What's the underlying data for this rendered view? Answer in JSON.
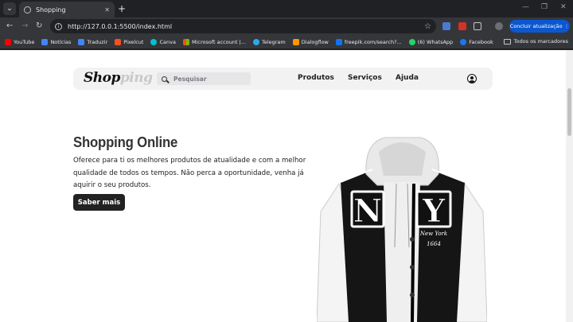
{
  "browser": {
    "tab_title": "Shopping",
    "url": "http://127.0.0.1:5500/index.html",
    "update_button": "Concluir atualização",
    "bookmarks": [
      {
        "label": "YouTube",
        "color": "#ff0000"
      },
      {
        "label": "Notícias",
        "color": "#4285f4"
      },
      {
        "label": "Traduzir",
        "color": "#4285f4"
      },
      {
        "label": "Pixelcut",
        "color": "#f4511e"
      },
      {
        "label": "Canva",
        "color": "#00c4cc"
      },
      {
        "label": "Microsoft account |...",
        "color": "#f25022"
      },
      {
        "label": "Telegram",
        "color": "#29a9eb"
      },
      {
        "label": "Dialogflow",
        "color": "#ff9800"
      },
      {
        "label": "freepik.com/search?...",
        "color": "#1273eb"
      },
      {
        "label": "(6) WhatsApp",
        "color": "#25d366"
      },
      {
        "label": "Facebook",
        "color": "#1877f2"
      }
    ],
    "all_bookmarks": "Todos os marcadores"
  },
  "site": {
    "logo_main": "Shop",
    "logo_faded": "ping",
    "search_placeholder": "Pesquisar",
    "nav": [
      "Produtos",
      "Serviços",
      "Ajuda"
    ],
    "hero_title": "Shopping Online",
    "hero_text": "Oferece para ti os melhores produtos de atualidade e com a melhor qualidade de todos os tempos. Não perca a oportunidade, venha já aquirir o seu produtos.",
    "cta": "Saber mais",
    "jacket_letters": [
      "N",
      "Y"
    ],
    "jacket_script": "New York",
    "jacket_number": "1664"
  }
}
